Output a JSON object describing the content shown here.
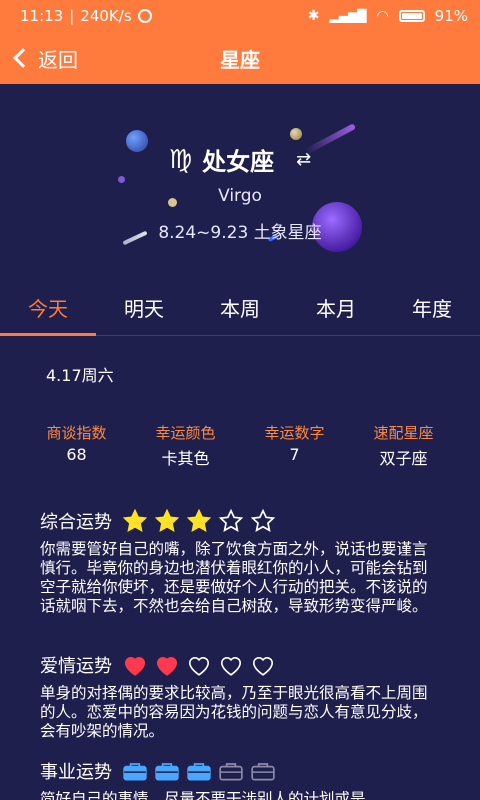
{
  "status": {
    "time": "11:13",
    "speed": "240K/s",
    "battery": "91%"
  },
  "nav": {
    "back": "返回",
    "title": "星座"
  },
  "sign": {
    "glyph": "♍",
    "name": "处女座",
    "swap": "⇄",
    "en": "Virgo",
    "range": "8.24~9.23 土象星座"
  },
  "tabs": [
    {
      "label": "今天",
      "active": true
    },
    {
      "label": "明天"
    },
    {
      "label": "本周"
    },
    {
      "label": "本月"
    },
    {
      "label": "年度"
    }
  ],
  "date": "4.17周六",
  "stats": [
    {
      "label": "商谈指数",
      "value": "68"
    },
    {
      "label": "幸运颜色",
      "value": "卡其色"
    },
    {
      "label": "幸运数字",
      "value": "7"
    },
    {
      "label": "速配星座",
      "value": "双子座"
    }
  ],
  "sections": {
    "overall": {
      "title": "综合运势",
      "rating": 3,
      "max": 5,
      "icon": "star-icon",
      "text": "你需要管好自己的嘴，除了饮食方面之外，说话也要谨言慎行。毕竟你的身边也潜伏着眼红你的小人，可能会钻到空子就给你使坏，还是要做好个人行动的把关。不该说的话就咽下去，不然也会给自己树敌，导致形势变得严峻。"
    },
    "love": {
      "title": "爱情运势",
      "rating": 2,
      "max": 5,
      "icon": "heart-icon",
      "text": "单身的对择偶的要求比较高，乃至于眼光很高看不上周围的人。恋爱中的容易因为花钱的问题与恋人有意见分歧，会有吵架的情况。"
    },
    "career": {
      "title": "事业运势",
      "rating": 3,
      "max": 5,
      "icon": "briefcase-icon",
      "text": "简好自己的事情，尽量不要干涉别人的计划或是"
    }
  },
  "colors": {
    "accent": "#ff7a3d",
    "background": "#1f1f4d",
    "star": "#ffe224",
    "heart": "#ff3a4f",
    "briefcase": "#4aa6ff"
  }
}
